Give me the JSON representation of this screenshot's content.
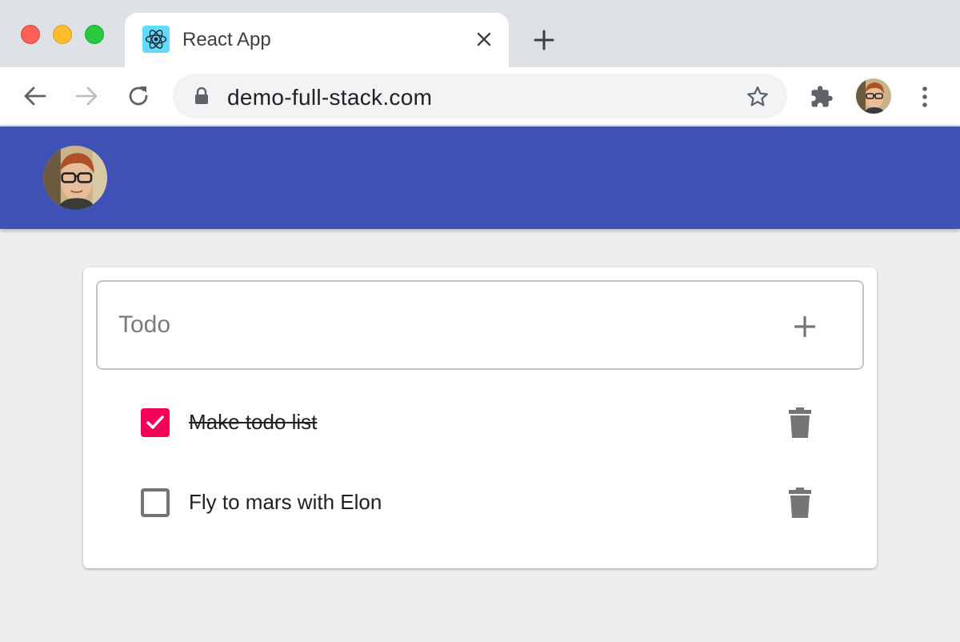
{
  "browser": {
    "tab": {
      "title": "React App",
      "favicon": "react-logo-icon"
    },
    "address": {
      "url": "demo-full-stack.com"
    },
    "icons": {
      "back": "arrow-left-icon",
      "forward": "arrow-right-icon",
      "reload": "reload-icon",
      "lock": "lock-icon",
      "bookmark": "star-outline-icon",
      "extensions": "puzzle-icon",
      "menu": "kebab-menu-icon",
      "close_tab": "close-icon",
      "new_tab": "plus-icon"
    }
  },
  "app": {
    "colors": {
      "appbar": "#3f51b5",
      "checkbox_checked": "#f50057",
      "icon_grey": "#757575"
    },
    "todo_input": {
      "placeholder": "Todo",
      "value": ""
    },
    "todos": [
      {
        "text": "Make todo list",
        "completed": true
      },
      {
        "text": "Fly to mars with Elon",
        "completed": false
      }
    ]
  }
}
